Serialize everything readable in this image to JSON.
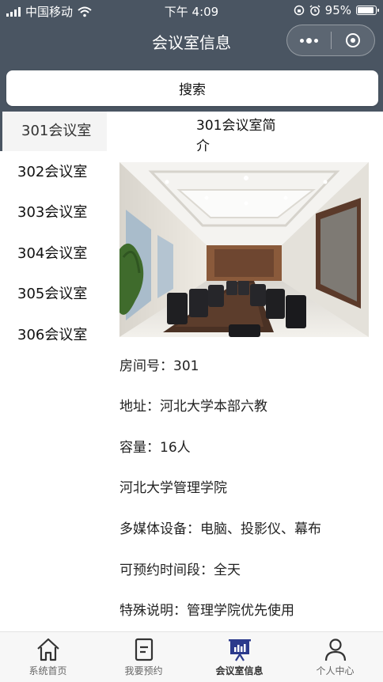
{
  "status_bar": {
    "carrier": "中国移动",
    "time": "下午 4:09",
    "battery": "95%",
    "battery_level": 0.95
  },
  "nav": {
    "title": "会议室信息"
  },
  "search": {
    "label": "搜索"
  },
  "sidebar": {
    "items": [
      {
        "label": "301会议室"
      },
      {
        "label": "302会议室"
      },
      {
        "label": "303会议室"
      },
      {
        "label": "304会议室"
      },
      {
        "label": "305会议室"
      },
      {
        "label": "306会议室"
      }
    ]
  },
  "room": {
    "intro_title": "301会议室简介",
    "room_no": "房间号：301",
    "address": "地址：河北大学本部六教",
    "capacity": "容量：16人",
    "department": "河北大学管理学院",
    "equipment": "多媒体设备：电脑、投影仪、幕布",
    "available": "可预约时间段：全天",
    "note": "特殊说明：管理学院优先使用"
  },
  "tabs": [
    {
      "label": "系统首页",
      "icon": "home-icon"
    },
    {
      "label": "我要预约",
      "icon": "document-icon"
    },
    {
      "label": "会议室信息",
      "icon": "presentation-board-icon"
    },
    {
      "label": "个人中心",
      "icon": "user-icon"
    }
  ],
  "colors": {
    "header": "#4a5562",
    "active_tab_icon": "#2b3a8c",
    "tab_bar": "#f7f7f7"
  }
}
